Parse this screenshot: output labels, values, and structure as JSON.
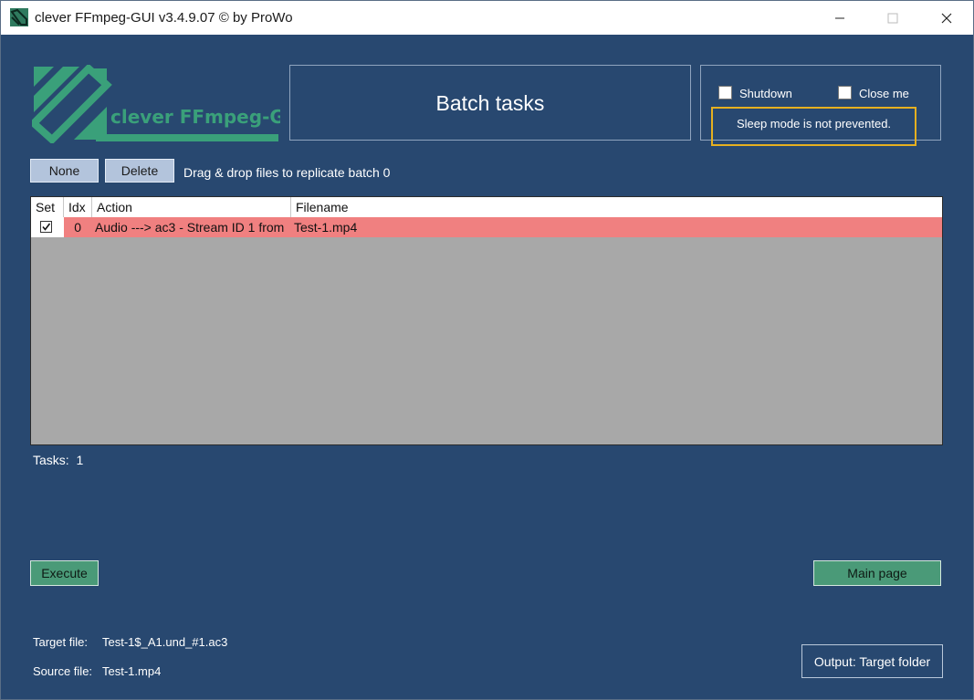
{
  "window": {
    "title": "clever FFmpeg-GUI v3.4.9.07   © by ProWo",
    "controls": {
      "minimize": "—",
      "maximize": "☐",
      "close": "✕"
    }
  },
  "logo": {
    "text": "clever FFmpeg-GUI",
    "color": "#3aa07a"
  },
  "header": {
    "title": "Batch tasks"
  },
  "options": {
    "shutdown_label": "Shutdown",
    "shutdown_checked": false,
    "close_me_label": "Close me",
    "close_me_checked": false,
    "sleep_status": "Sleep mode is not prevented."
  },
  "toolbar": {
    "none_label": "None",
    "delete_label": "Delete",
    "hint": "Drag & drop files to replicate batch 0"
  },
  "table": {
    "columns": [
      "Set",
      "Idx",
      "Action",
      "Filename"
    ],
    "rows": [
      {
        "set": true,
        "idx": "0",
        "action": "Audio ---> ac3 - Stream ID 1 from",
        "filename": "Test-1.mp4"
      }
    ]
  },
  "status": {
    "tasks_label": "Tasks:",
    "tasks_count": "1"
  },
  "actions": {
    "execute_label": "Execute",
    "main_page_label": "Main page"
  },
  "files": {
    "target_label": "Target file:",
    "target_value": "Test-1$_A1.und_#1.ac3",
    "source_label": "Source file:",
    "source_value": "Test-1.mp4"
  },
  "output": {
    "label": "Output: Target folder"
  },
  "colors": {
    "background": "#284870",
    "row_highlight": "#f08080",
    "green_button": "#4a9a78",
    "blue_button": "#b3c4dc",
    "highlight_border": "#e6b020"
  }
}
